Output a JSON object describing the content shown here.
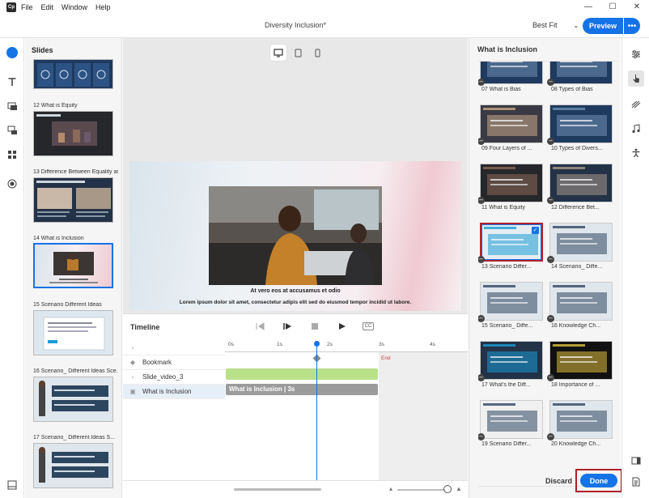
{
  "app": {
    "logo": "Cp"
  },
  "menu": [
    "File",
    "Edit",
    "Window",
    "Help"
  ],
  "window_controls": {
    "minimize": "—",
    "maximize": "☐",
    "close": "✕"
  },
  "toolbar": {
    "doc_title": "Diversity Inclusion*",
    "fit": "Best Fit",
    "preview": "Preview",
    "more": "•••"
  },
  "slides_panel": {
    "header": "Slides",
    "slides": [
      {
        "label": "12  What is Equity"
      },
      {
        "label": "13  Difference Between Equality and Equity"
      },
      {
        "label": "14  What is Inclusion"
      },
      {
        "label": "15  Scenario Different Ideas"
      },
      {
        "label": "16  Scenario_ Different Ideas Sce..."
      },
      {
        "label": "17  Scenario_ Different Ideas S..."
      }
    ]
  },
  "canvas": {
    "title": "At vero eos at accusamus et odio",
    "body": "Lorem ipsum dolor sit amet, consectetur adipis elit sed do eiusmod tempor incidid ut labore."
  },
  "timeline": {
    "title": "Timeline",
    "cc_label": "CC",
    "ruler": [
      "0s",
      "1s",
      "2s",
      "3s",
      "4s"
    ],
    "end_label": "End",
    "rows": [
      {
        "label": "Bookmark"
      },
      {
        "label": "Slide_video_3"
      },
      {
        "label": "What is Inclusion"
      }
    ],
    "clip_label": "What is Inclusion | 3s"
  },
  "right_panel": {
    "title": "What is Inclusion",
    "items": [
      {
        "label": "07 What is Bias"
      },
      {
        "label": "08 Types of Bias"
      },
      {
        "label": "09 Four Layers of ..."
      },
      {
        "label": "10 Types of Divers..."
      },
      {
        "label": "11 What is Equity"
      },
      {
        "label": "12 Difference Bet..."
      },
      {
        "label": "13 Scenario Differ...",
        "selected": true
      },
      {
        "label": "14 Scenario_ Diffe..."
      },
      {
        "label": "15 Scenario_ Diffe..."
      },
      {
        "label": "16 Knowledge Ch..."
      },
      {
        "label": "17 What's the Diff..."
      },
      {
        "label": "18 Importance of ..."
      },
      {
        "label": "19 Scenario Differ..."
      },
      {
        "label": "20 Knowledge Ch..."
      }
    ],
    "discard": "Discard",
    "done": "Done"
  },
  "colors": {
    "accent": "#1473e6",
    "highlight": "#b0202a",
    "track_green": "#b9e18a",
    "track_gray": "#9b9b9b"
  }
}
